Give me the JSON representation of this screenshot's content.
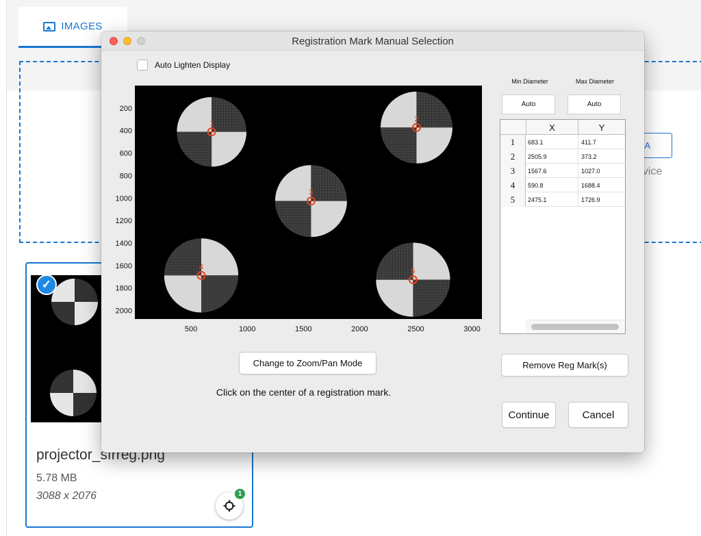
{
  "background": {
    "tab_label": "IMAGES",
    "button_fragment": "RA",
    "device_fragment": "evice",
    "file": {
      "name": "projector_sfrreg.png",
      "size": "5.78 MB",
      "dimensions": "3088 x 2076",
      "badge_count": "1"
    }
  },
  "dialog": {
    "title": "Registration Mark Manual Selection",
    "auto_lighten_label": "Auto Lighten Display",
    "auto_lighten_checked": false,
    "min_diameter_label": "Min Diameter",
    "max_diameter_label": "Max Diameter",
    "min_diameter_value": "Auto",
    "max_diameter_value": "Auto",
    "table": {
      "headers": [
        "X",
        "Y"
      ],
      "rows": [
        {
          "index": "1",
          "x": "683.1",
          "y": "411.7"
        },
        {
          "index": "2",
          "x": "2505.9",
          "y": "373.2"
        },
        {
          "index": "3",
          "x": "1567.6",
          "y": "1027.0"
        },
        {
          "index": "4",
          "x": "590.8",
          "y": "1688.4"
        },
        {
          "index": "5",
          "x": "2475.1",
          "y": "1726.9"
        }
      ]
    },
    "zoom_button": "Change to Zoom/Pan Mode",
    "remove_button": "Remove Reg Mark(s)",
    "status": "Click on the center of a registration mark.",
    "continue_button": "Continue",
    "cancel_button": "Cancel"
  },
  "chart_data": {
    "type": "scatter",
    "title": "",
    "xlabel": "",
    "ylabel": "",
    "xlim": [
      0,
      3088
    ],
    "ylim": [
      2076,
      0
    ],
    "y_inverted": true,
    "x_ticks": [
      500,
      1000,
      1500,
      2000,
      2500,
      3000
    ],
    "y_ticks": [
      200,
      400,
      600,
      800,
      1000,
      1200,
      1400,
      1600,
      1800,
      2000
    ],
    "marker_color": "#e0441a",
    "grid": false,
    "marks": [
      {
        "label": "1",
        "x": 683.1,
        "y": 411.7,
        "radius": 310,
        "rotation": 0
      },
      {
        "label": "2",
        "x": 2505.9,
        "y": 373.2,
        "radius": 320,
        "rotation": 0
      },
      {
        "label": "3",
        "x": 1567.6,
        "y": 1027.0,
        "radius": 320,
        "rotation": 0
      },
      {
        "label": "4",
        "x": 590.8,
        "y": 1688.4,
        "radius": 330,
        "rotation": 90
      },
      {
        "label": "5",
        "x": 2475.1,
        "y": 1726.9,
        "radius": 330,
        "rotation": 90
      }
    ]
  },
  "colors": {
    "accent": "#1976d2",
    "marker": "#e0441a",
    "badge": "#2e9e4f"
  }
}
